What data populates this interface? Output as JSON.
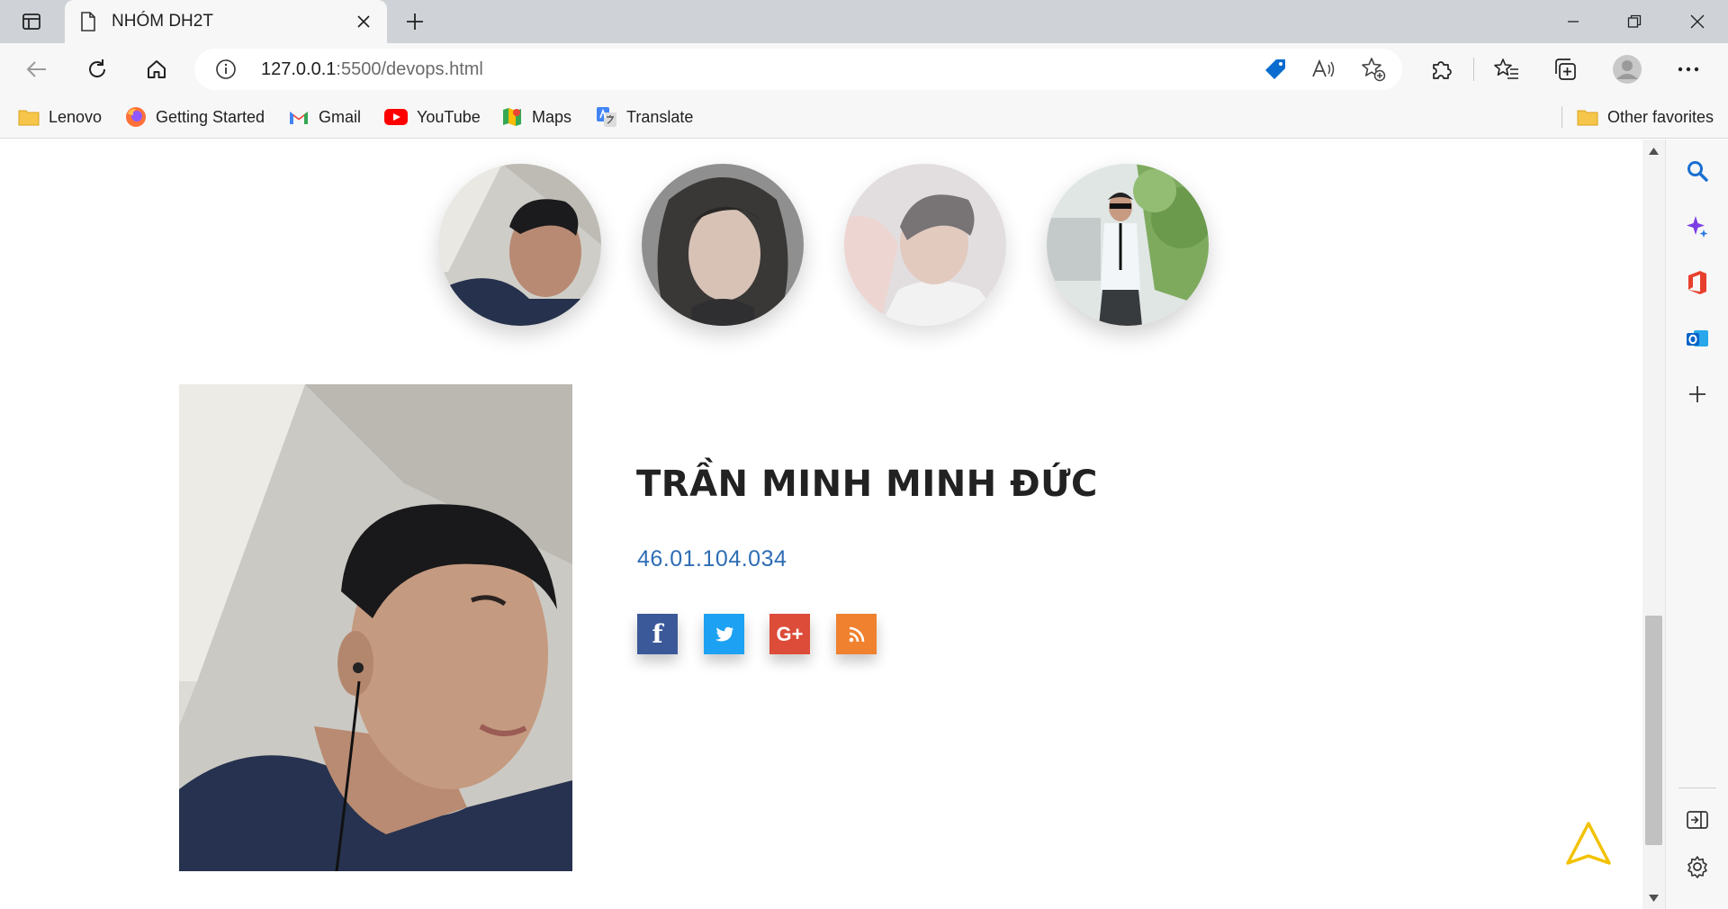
{
  "browser": {
    "tab": {
      "title": "NHÓM DH2T"
    },
    "address": {
      "host": "127.0.0.1",
      "rest": ":5500/devops.html"
    },
    "favorites": [
      {
        "label": "Lenovo",
        "icon": "folder-icon"
      },
      {
        "label": "Getting Started",
        "icon": "firefox-icon"
      },
      {
        "label": "Gmail",
        "icon": "gmail-icon"
      },
      {
        "label": "YouTube",
        "icon": "youtube-icon"
      },
      {
        "label": "Maps",
        "icon": "maps-icon"
      },
      {
        "label": "Translate",
        "icon": "translate-icon"
      }
    ],
    "other_favorites": "Other favorites"
  },
  "page": {
    "member": {
      "name": "TRẦN MINH MINH ĐỨC",
      "id": "46.01.104.034"
    },
    "social": [
      {
        "icon": "facebook-icon",
        "glyph": "f",
        "color": "#3b5998"
      },
      {
        "icon": "twitter-icon",
        "glyph": "t",
        "color": "#1da1f2"
      },
      {
        "icon": "google-plus-icon",
        "glyph": "G+",
        "color": "#dd4b39"
      },
      {
        "icon": "rss-icon",
        "glyph": "rss",
        "color": "#f0812e"
      }
    ]
  },
  "colors": {
    "tabstrip": "#cfd3d8",
    "toolbar": "#f7f7f7",
    "link_blue": "#2e6db4",
    "back_to_top": "#f2c200"
  }
}
